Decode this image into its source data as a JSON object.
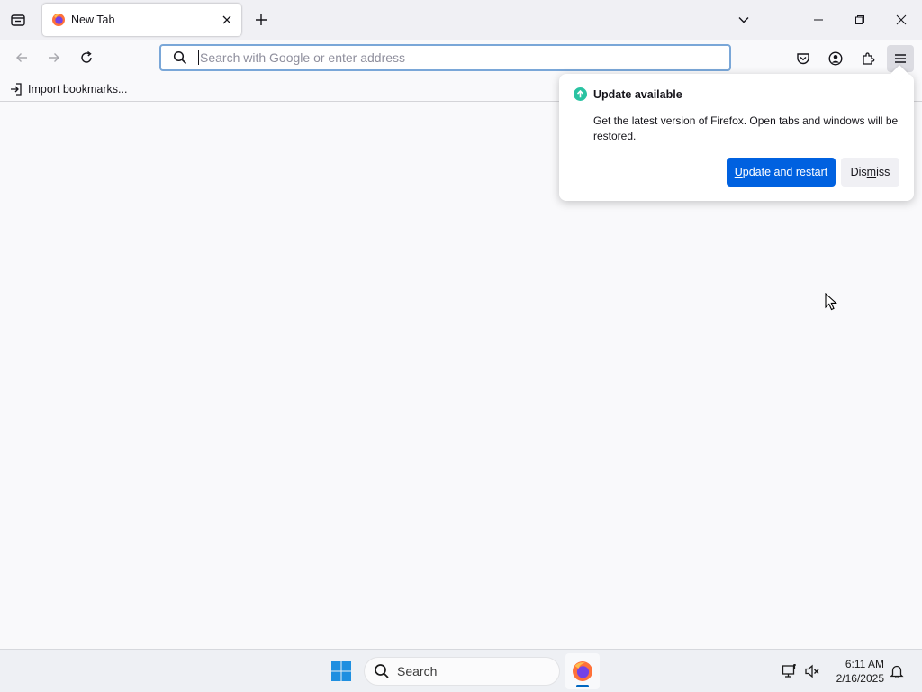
{
  "tab": {
    "title": "New Tab"
  },
  "urlbar": {
    "placeholder": "Search with Google or enter address"
  },
  "bookmarks": {
    "import_label": "Import bookmarks..."
  },
  "update_panel": {
    "title": "Update available",
    "description": "Get the latest version of Firefox. Open tabs and windows will be restored.",
    "primary_pre": "",
    "primary_accel": "U",
    "primary_post": "pdate and restart",
    "secondary_pre": "Dis",
    "secondary_accel": "m",
    "secondary_post": "iss"
  },
  "taskbar": {
    "search_label": "Search",
    "time": "6:11 AM",
    "date": "2/16/2025"
  },
  "colors": {
    "accent": "#0061e0",
    "update_badge": "#2ac3a2",
    "taskbar_indicator": "#0067c0"
  },
  "icons": [
    "tab-list-icon",
    "firefox-icon",
    "close-icon",
    "plus-icon",
    "chevron-down-icon",
    "minimize-icon",
    "restore-icon",
    "back-icon",
    "forward-icon",
    "reload-icon",
    "search-icon",
    "pocket-icon",
    "account-icon",
    "extensions-icon",
    "hamburger-menu-icon",
    "import-icon",
    "update-arrow-icon",
    "windows-start-icon",
    "network-icon",
    "volume-muted-icon",
    "notification-bell-icon"
  ]
}
